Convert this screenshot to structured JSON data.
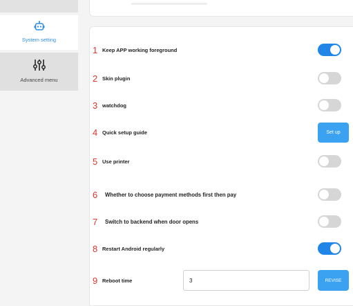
{
  "sidebar": {
    "items": [
      {
        "label": "System setting",
        "icon": "robot-icon",
        "active": true
      },
      {
        "label": "Advanced menu",
        "icon": "sliders-icon",
        "active": false
      }
    ]
  },
  "colors": {
    "accent": "#1f86e8",
    "button": "#3aa2f0",
    "number": "#d9372e"
  },
  "settings": [
    {
      "num": "1",
      "label": "Keep APP working foreground",
      "control": "toggle",
      "on": true
    },
    {
      "num": "2",
      "label": "Skin plugin",
      "control": "toggle",
      "on": false
    },
    {
      "num": "3",
      "label": "watchdog",
      "control": "toggle",
      "on": false
    },
    {
      "num": "4",
      "label": "Quick setup guide",
      "control": "button",
      "button_label": "Set up"
    },
    {
      "num": "5",
      "label": "Use printer",
      "control": "toggle",
      "on": false
    },
    {
      "num": "6",
      "label": "Whether to choose payment  methods first then pay",
      "control": "toggle",
      "on": false
    },
    {
      "num": "7",
      "label": "Switch to backend when door opens",
      "control": "toggle",
      "on": false
    },
    {
      "num": "8",
      "label": "Restart Android regularly",
      "control": "toggle",
      "on": true
    },
    {
      "num": "9",
      "label": "Reboot time",
      "control": "input",
      "value": "3",
      "button_label": "REVISE"
    }
  ]
}
